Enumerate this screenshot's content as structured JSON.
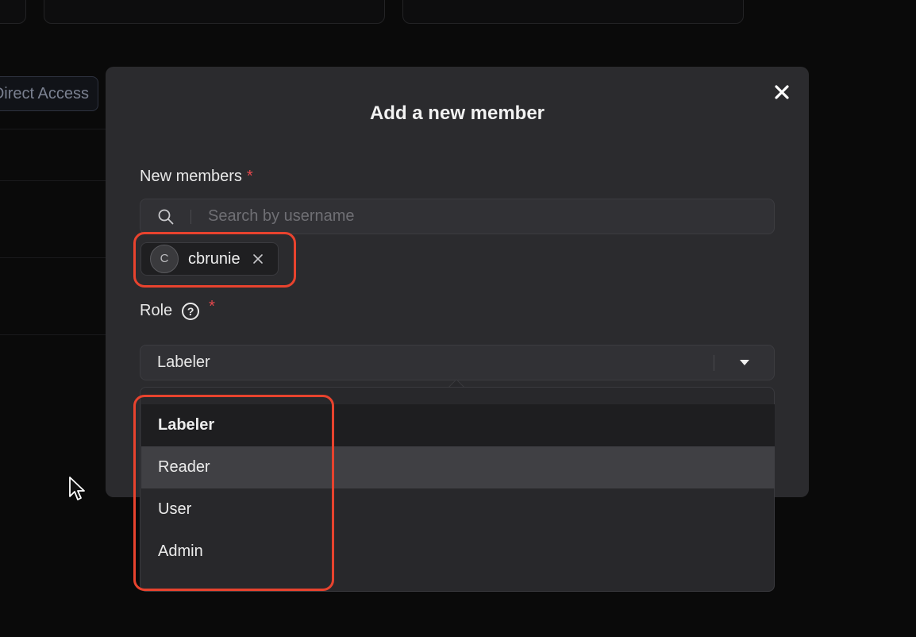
{
  "background": {
    "direct_access_label": "Direct Access"
  },
  "modal": {
    "title": "Add a new member",
    "new_members_label": "New members",
    "required_mark": "*",
    "search_placeholder": "Search by username",
    "selected_members": [
      {
        "initial": "C",
        "username": "cbrunie"
      }
    ],
    "role_label": "Role",
    "help_icon_glyph": "?",
    "role_value": "Labeler",
    "role_options": [
      "Labeler",
      "Reader",
      "User",
      "Admin"
    ],
    "role_selected_index": 0,
    "role_hover_index": 1
  },
  "colors": {
    "highlight": "#e8432e",
    "required": "#e5484d",
    "modal_bg": "#2b2b2e"
  },
  "icons": [
    "close-icon",
    "search-icon",
    "remove-icon",
    "help-icon",
    "chevron-down-icon",
    "mouse-cursor-icon"
  ]
}
